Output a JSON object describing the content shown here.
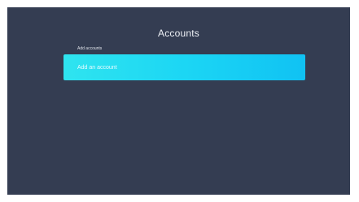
{
  "page": {
    "title": "Accounts"
  },
  "section": {
    "label": "Add accounts"
  },
  "add_account": {
    "label": "Add an account"
  },
  "colors": {
    "background": "#343d52",
    "accent_start": "#2fe4ef",
    "accent_end": "#10c2f3"
  }
}
